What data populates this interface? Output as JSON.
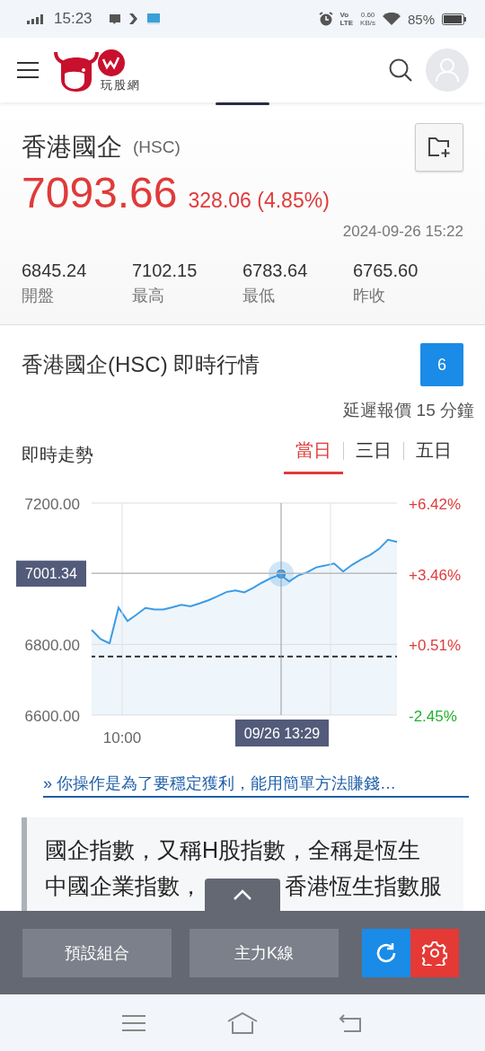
{
  "status_bar": {
    "time": "15:23",
    "volte_top": "Vo",
    "volte_bottom": "LTE",
    "speed_value": "0.60",
    "speed_unit": "KB/s",
    "battery": "85%"
  },
  "header": {
    "logo_text": "玩股網"
  },
  "quote": {
    "name": "香港國企",
    "code": "(HSC)",
    "price": "7093.66",
    "change": "328.06 (4.85%)",
    "updated": "2024-09-26 15:22",
    "stats": [
      {
        "value": "6845.24",
        "label": "開盤"
      },
      {
        "value": "7102.15",
        "label": "最高"
      },
      {
        "value": "6783.64",
        "label": "最低"
      },
      {
        "value": "6765.60",
        "label": "昨收"
      }
    ]
  },
  "realtime": {
    "title": "香港國企(HSC) 即時行情",
    "badge": "6",
    "delay_note": "延遲報價 15 分鐘",
    "trend_label": "即時走勢",
    "tabs": [
      {
        "label": "當日",
        "selected": true
      },
      {
        "label": "三日",
        "selected": false
      },
      {
        "label": "五日",
        "selected": false
      }
    ],
    "chart_data": {
      "type": "area",
      "series": [
        {
          "color": "#3d9be3",
          "values": [
            6841,
            6815,
            6803,
            6904,
            6866,
            6884,
            6903,
            6899,
            6899,
            6905,
            6912,
            6908,
            6916,
            6925,
            6936,
            6948,
            6953,
            6947,
            6960,
            6975,
            6988,
            6997,
            6978,
            6995,
            7004,
            7018,
            7023,
            7029,
            7006,
            7025,
            7040,
            7053,
            7070,
            7096,
            7090
          ]
        }
      ],
      "ylim": [
        6600,
        7200
      ],
      "yticks": [
        {
          "value": 6600,
          "label": "6600.00"
        },
        {
          "value": 6800,
          "label": "6800.00"
        },
        {
          "value": 7200,
          "label": "7200.00"
        }
      ],
      "annotations": [
        "10:00"
      ]
    },
    "right_axis": [
      {
        "label": "+6.42%",
        "kind": "up"
      },
      {
        "label": "+3.46%",
        "kind": "up"
      },
      {
        "label": "+0.51%",
        "kind": "up"
      },
      {
        "label": "-2.45%",
        "kind": "down"
      }
    ],
    "cursor": {
      "value_label": "7001.34",
      "time_label": "09/26 13:29"
    }
  },
  "article_link": "» 你操作是為了要穩定獲利，能用簡單方法賺錢…",
  "description": {
    "line_1": "國企指數，又稱H股指數，全稱是恆生",
    "line_2_start": "中國企業指數，",
    "line_2_end": "香港恆生指數服"
  },
  "toolbar": {
    "buttons": [
      "預設組合",
      "主力K線"
    ]
  }
}
